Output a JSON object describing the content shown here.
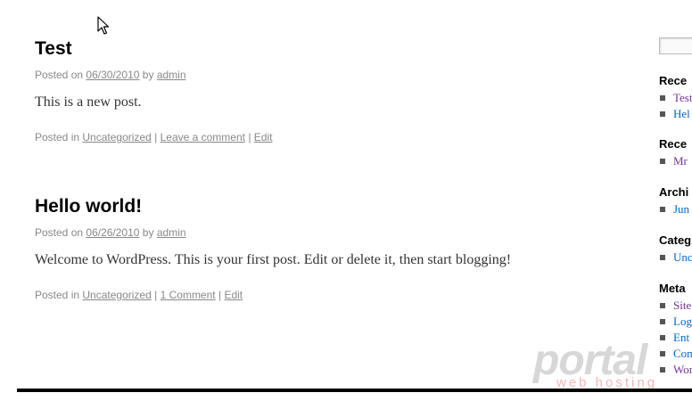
{
  "posts": [
    {
      "title": "Test",
      "posted_on": "Posted on",
      "date": "06/30/2010",
      "by": "by",
      "author": "admin",
      "content": "This is a new post.",
      "posted_in": "Posted in",
      "category": "Uncategorized",
      "comments": "Leave a comment",
      "edit": "Edit"
    },
    {
      "title": "Hello world!",
      "posted_on": "Posted on",
      "date": "06/26/2010",
      "by": "by",
      "author": "admin",
      "content": "Welcome to WordPress. This is your first post. Edit or delete it, then start blogging!",
      "posted_in": "Posted in",
      "category": "Uncategorized",
      "comments": "1 Comment",
      "edit": "Edit"
    }
  ],
  "separator": "|",
  "sidebar": {
    "recent_posts": {
      "title": "Rece",
      "items": [
        "Test",
        "Hel"
      ]
    },
    "recent_comments": {
      "title": "Rece",
      "items": [
        "Mr"
      ]
    },
    "archives": {
      "title": "Archi",
      "items": [
        "Jun"
      ]
    },
    "categories": {
      "title": "Categ",
      "items": [
        "Unc"
      ]
    },
    "meta": {
      "title": "Meta",
      "items": [
        "Site",
        "Log",
        "Ent",
        "Com",
        "Wor"
      ]
    }
  },
  "watermark": {
    "main": "portal",
    "sub": "web hosting"
  },
  "colors": {
    "link_visited": "#743399",
    "link": "#0066cc",
    "meta_text": "#888888"
  }
}
